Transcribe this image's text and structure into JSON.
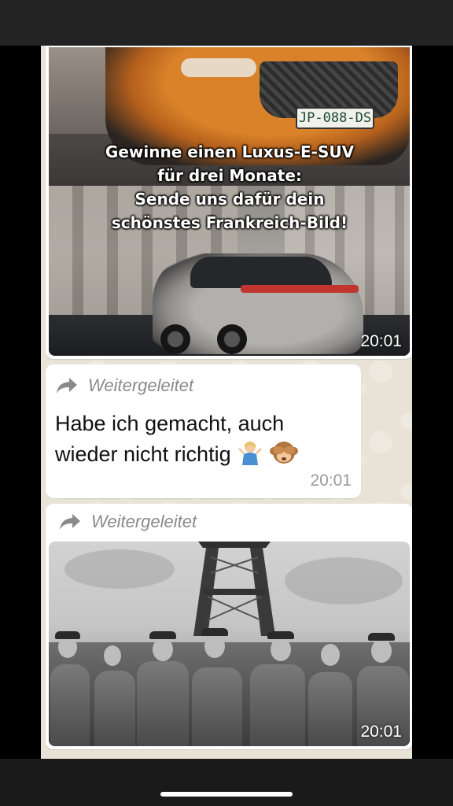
{
  "messages": [
    {
      "type": "image",
      "overlay_lines": [
        "Gewinne einen Luxus-E-SUV",
        "für drei Monate:",
        "Sende uns dafür dein",
        "schönstes Frankreich-Bild!"
      ],
      "plate": "JP-088-DS",
      "time": "20:01"
    },
    {
      "type": "text",
      "forwarded_label": "Weitergeleitet",
      "text_line1": "Habe ich gemacht, auch",
      "text_line2": "wieder nicht richtig",
      "emojis": [
        "person-shrugging",
        "see-no-evil-monkey"
      ],
      "time": "20:01"
    },
    {
      "type": "image",
      "forwarded_label": "Weitergeleitet",
      "time": "20:01"
    }
  ],
  "colors": {
    "chat_background": "#e9e3d7",
    "bubble": "#ffffff",
    "forwarded_text": "#8a8a8a",
    "timestamp": "#9a9a9a"
  }
}
